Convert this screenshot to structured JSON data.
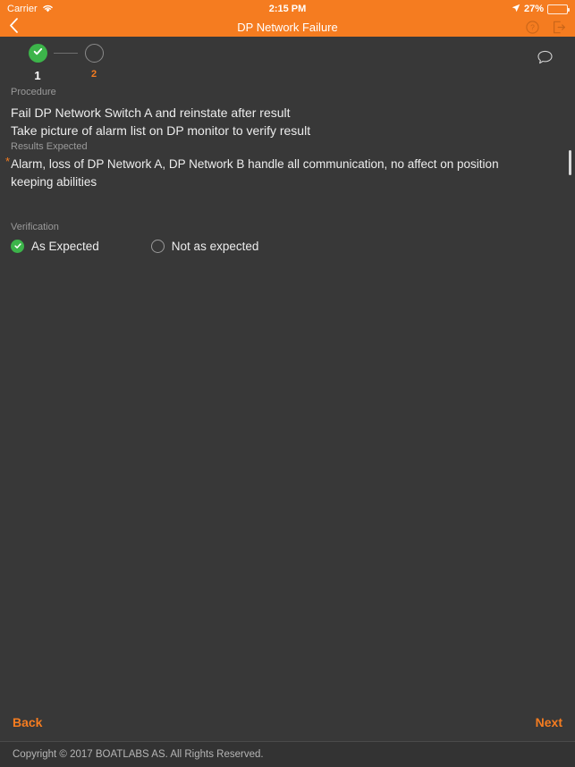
{
  "colors": {
    "accent_orange": "#F57C20",
    "background": "#383838",
    "success_green": "#3CB44A",
    "footer_background": "#333333",
    "muted_text": "#9a9a9a"
  },
  "status_bar": {
    "carrier": "Carrier",
    "wifi_icon": "wifi-icon",
    "time": "2:15 PM",
    "location_icon": "location-arrow-icon",
    "battery_percent": "27%",
    "battery_level": 27
  },
  "nav_bar": {
    "back_icon": "chevron-left-icon",
    "title": "DP Network Failure",
    "help_icon": "help-circle-icon",
    "logout_icon": "logout-icon"
  },
  "stepper": {
    "steps": [
      {
        "label": "1",
        "state": "done",
        "icon": "check-icon"
      },
      {
        "label": "2",
        "state": "todo",
        "icon": ""
      }
    ],
    "comment_icon": "comment-bubble-icon"
  },
  "procedure": {
    "label": "Procedure",
    "lines": [
      "Fail DP Network Switch A and reinstate after result",
      "Take picture of alarm list on DP monitor to verify result"
    ]
  },
  "results_expected": {
    "label": "Results Expected",
    "bullet": "*",
    "text": "Alarm, loss of DP Network A, DP Network B handle all communication, no affect on position keeping abilities"
  },
  "verification": {
    "label": "Verification",
    "options": [
      {
        "label": "As Expected",
        "selected": true
      },
      {
        "label": "Not as expected",
        "selected": false
      }
    ]
  },
  "actions": {
    "back_label": "Back",
    "next_label": "Next"
  },
  "footer": {
    "copyright": "Copyright © 2017 BOATLABS AS. All Rights Reserved."
  }
}
